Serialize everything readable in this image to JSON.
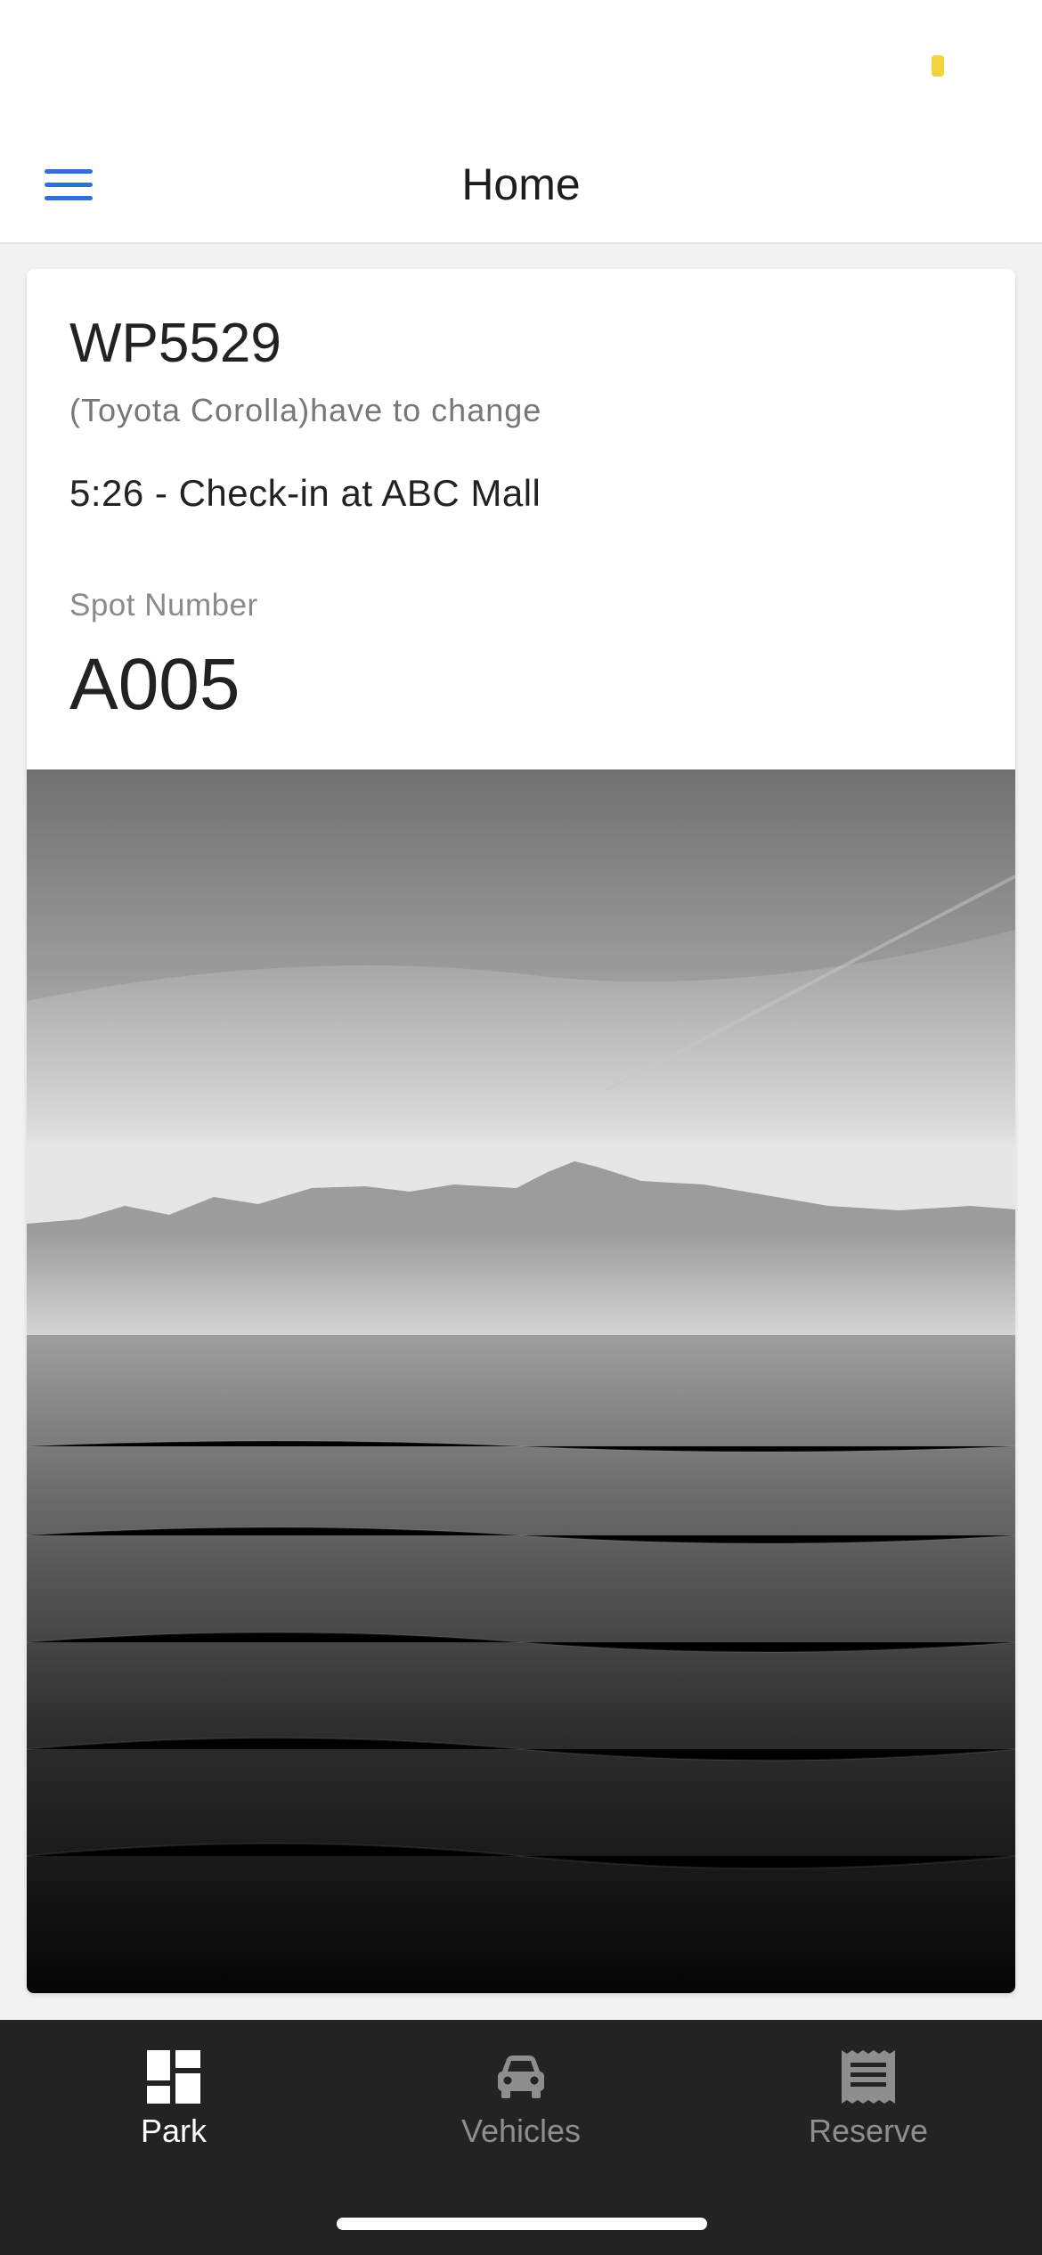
{
  "header": {
    "title": "Home",
    "menu_icon": "hamburger-menu-icon",
    "accent_color": "#2f6fd6"
  },
  "card": {
    "plate": "WP5529",
    "model": "(Toyota Corolla)have to change",
    "checkin": "5:26 - Check-in at ABC Mall",
    "spot_label": "Spot Number",
    "spot_number": "A005",
    "photo_icon": "lake-mountain-photo"
  },
  "tabs": [
    {
      "label": "Park",
      "icon": "dashboard-grid-icon",
      "active": true,
      "color": "#ffffff"
    },
    {
      "label": "Vehicles",
      "icon": "car-icon",
      "active": false,
      "color": "#8e8e8e"
    },
    {
      "label": "Reserve",
      "icon": "receipt-icon",
      "active": false,
      "color": "#8e8e8e"
    }
  ]
}
